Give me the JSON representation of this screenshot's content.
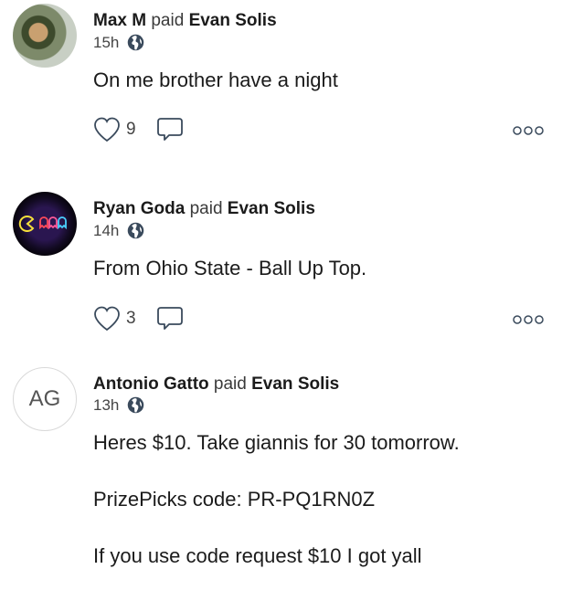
{
  "posts": [
    {
      "sender": "Max M",
      "verb": "paid",
      "recipient": "Evan Solis",
      "time": "15h",
      "message_lines": [
        "On me brother have a night"
      ],
      "likes": "9",
      "avatar": "photo"
    },
    {
      "sender": "Ryan Goda",
      "verb": "paid",
      "recipient": "Evan Solis",
      "time": "14h",
      "message_lines": [
        "From Ohio State - Ball Up Top."
      ],
      "likes": "3",
      "avatar": "neon"
    },
    {
      "sender": "Antonio Gatto",
      "verb": "paid",
      "recipient": "Evan Solis",
      "time": "13h",
      "initials": "AG",
      "message_lines": [
        "Heres $10. Take giannis for 30 tomorrow.",
        "PrizePicks code: PR-PQ1RN0Z",
        "If you use code request $10 I got yall"
      ]
    }
  ],
  "icons": {
    "globe": "globe-icon",
    "like": "heart-icon",
    "comment": "comment-icon",
    "more": "more-options-icon"
  },
  "colors": {
    "text": "#1b1b1b",
    "muted": "#444444",
    "icon": "#3a4a5c"
  }
}
